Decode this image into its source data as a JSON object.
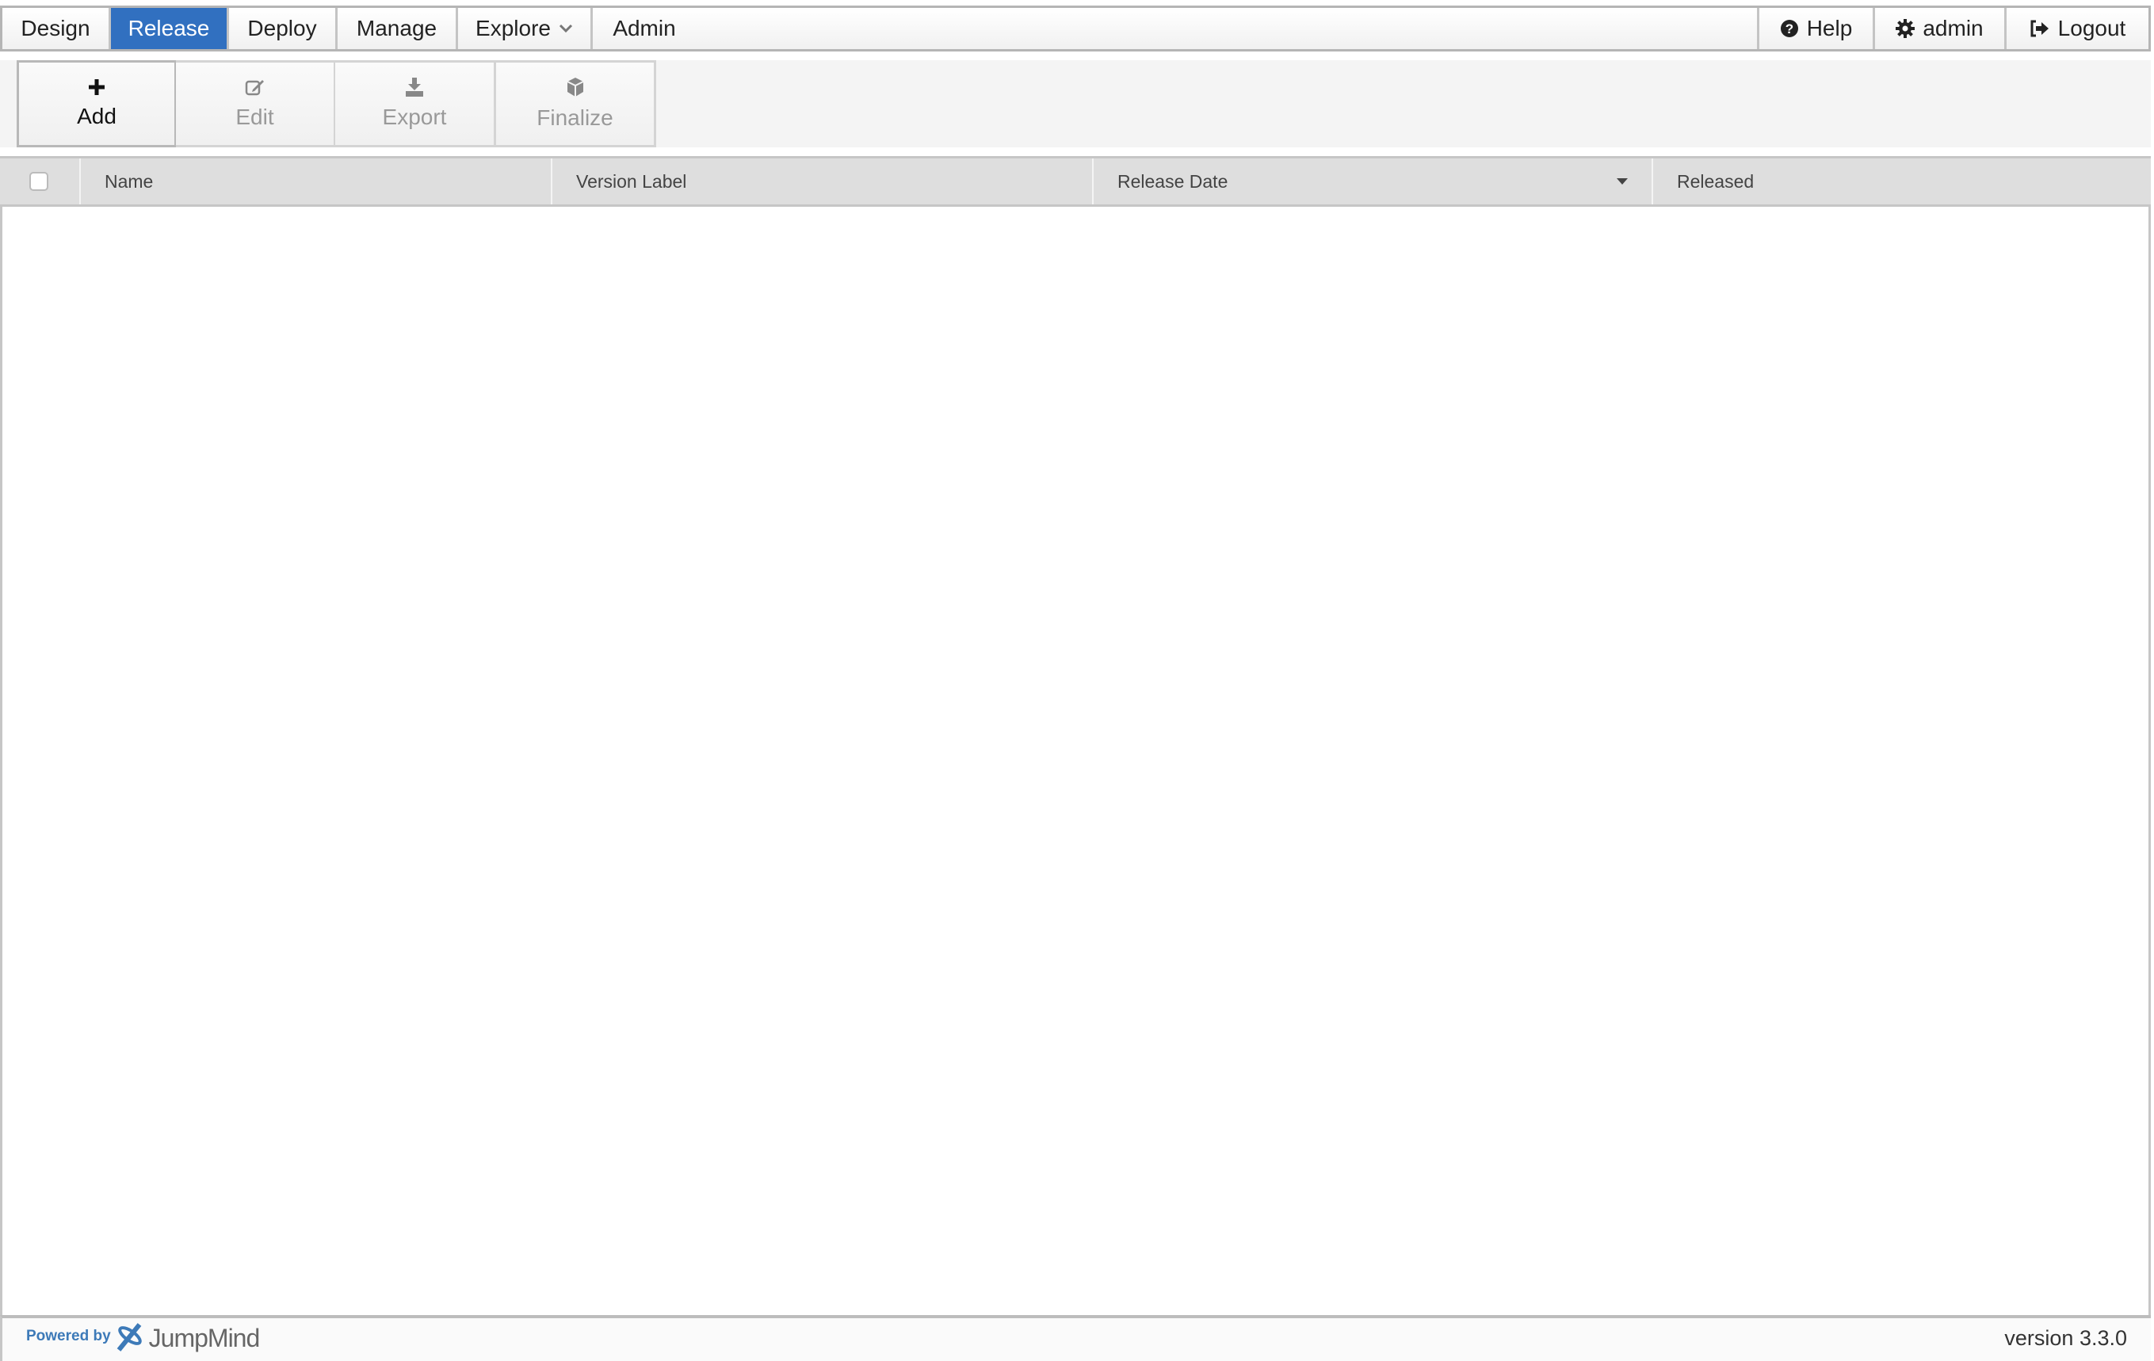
{
  "nav": {
    "tabs": [
      {
        "label": "Design",
        "active": false
      },
      {
        "label": "Release",
        "active": true
      },
      {
        "label": "Deploy",
        "active": false
      },
      {
        "label": "Manage",
        "active": false
      },
      {
        "label": "Explore",
        "active": false,
        "icon": "chevron-down-icon"
      },
      {
        "label": "Admin",
        "active": false
      }
    ],
    "right": [
      {
        "label": "Help",
        "icon": "question-circle-icon"
      },
      {
        "label": "admin",
        "icon": "gear-icon"
      },
      {
        "label": "Logout",
        "icon": "sign-out-icon"
      }
    ],
    "accent": "#3170c0"
  },
  "toolbar": {
    "buttons": [
      {
        "label": "Add",
        "icon": "plus-icon",
        "enabled": true
      },
      {
        "label": "Edit",
        "icon": "edit-icon",
        "enabled": false
      },
      {
        "label": "Export",
        "icon": "download-icon",
        "enabled": false
      },
      {
        "label": "Finalize",
        "icon": "cube-icon",
        "enabled": false
      }
    ]
  },
  "table": {
    "columns": [
      "Name",
      "Version Label",
      "Release Date",
      "Released"
    ],
    "sort_column": "Release Date",
    "rows": []
  },
  "footer": {
    "powered_by": "Powered by",
    "brand": "JumpMind",
    "version": "version 3.3.0"
  }
}
